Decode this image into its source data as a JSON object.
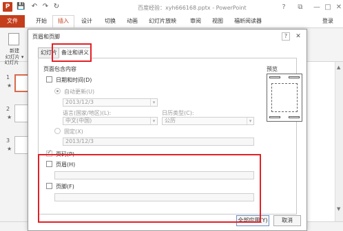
{
  "titlebar": {
    "app_logo": "P",
    "save_icon": "💾",
    "undo_icon": "↶",
    "redo_icon": "↷",
    "extra_icon": "↻",
    "title": "百度经验：xyh666168.pptx - PowerPoint",
    "help": "?",
    "restore": "⧉",
    "minimize": "—",
    "maximize": "□",
    "close": "✕"
  },
  "ribbon": {
    "tabs": [
      "文件",
      "开始",
      "插入",
      "设计",
      "切换",
      "动画",
      "幻灯片放映",
      "审阅",
      "视图",
      "福昕阅读器"
    ],
    "login": "登录"
  },
  "thumbnails": {
    "new_slide_label": "新建\n幻灯片 ▾",
    "section_label": "幻灯片",
    "slides": [
      {
        "no": "1",
        "star": "★"
      },
      {
        "no": "2",
        "star": "★"
      },
      {
        "no": "3",
        "star": "★"
      }
    ]
  },
  "dialog": {
    "title": "页眉和页脚",
    "help": "?",
    "close": "✕",
    "tabs": [
      "幻灯片",
      "备注和讲义"
    ],
    "group_label": "页面包含内容",
    "datetime_label": "日期和时间(D)",
    "auto_update_label": "自动更新(U)",
    "auto_update_value": "2013/12/3",
    "language_label": "语言(国家/地区)(L):",
    "language_value": "中文(中国)",
    "calendar_label": "日历类型(C):",
    "calendar_value": "公历",
    "fixed_label": "固定(X)",
    "fixed_value": "2013/12/3",
    "page_number_label": "页码(P)",
    "header_label": "页眉(H)",
    "header_value": "",
    "footer_label": "页脚(F)",
    "footer_value": "",
    "preview_label": "预览",
    "apply_all_button": "全部应用(Y)",
    "cancel_button": "取消"
  },
  "colors": {
    "accent": "#c43e1c",
    "highlight": "#e21f26"
  }
}
